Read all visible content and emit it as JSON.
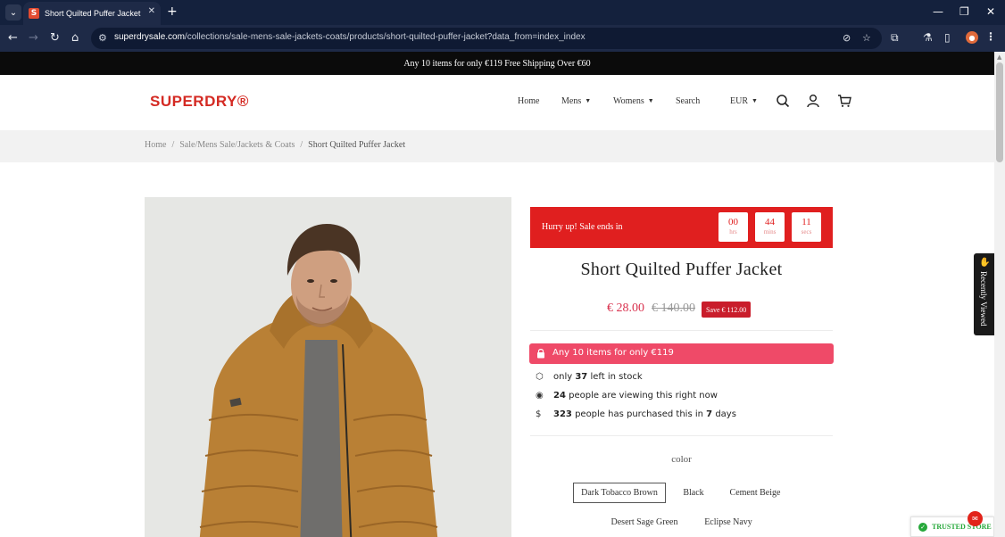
{
  "browser": {
    "tab_title": "Short Quilted Puffer Jacket - Su",
    "favicon_letter": "S",
    "url_host": "superdrysale.com",
    "url_path": "/collections/sale-mens-sale-jackets-coats/products/short-quilted-puffer-jacket?data_from=index_index"
  },
  "promo_bar": {
    "text": "Any 10 items for only €119 Free Shipping Over €60"
  },
  "header": {
    "logo": "SUPERDRY®",
    "nav": {
      "home": "Home",
      "mens": "Mens",
      "womens": "Womens",
      "search": "Search",
      "currency": "EUR"
    }
  },
  "breadcrumb": {
    "home": "Home",
    "category": "Sale/Mens Sale/Jackets & Coats",
    "current": "Short Quilted Puffer Jacket"
  },
  "sale_timer": {
    "label": "Hurry up!  Sale ends in",
    "hours": "00",
    "hours_unit": "hrs",
    "mins": "44",
    "mins_unit": "mins",
    "secs": "11",
    "secs_unit": "secs"
  },
  "product": {
    "title": "Short Quilted Puffer Jacket",
    "price_now": "€ 28.00",
    "price_was": "€ 140.00",
    "save_label": "Save € 112.00",
    "offer_text": "Any 10 items for only €119",
    "stock": {
      "prefix": "only",
      "count": "37",
      "suffix": "left in stock"
    },
    "viewing": {
      "count": "24",
      "suffix": "people are viewing this right now"
    },
    "purchased": {
      "count": "323",
      "mid": "people has purchased this in",
      "days": "7",
      "suffix": "days"
    },
    "color_label": "color",
    "colors": [
      "Dark Tobacco Brown",
      "Black",
      "Cement Beige",
      "Desert Sage Green",
      "Eclipse Navy"
    ],
    "selected_color": "Dark Tobacco Brown"
  },
  "recently_viewed": {
    "label": "Recently Viewed"
  },
  "trusted_badge": {
    "text": "TRUSTED STORE"
  },
  "colors": {
    "brand_red": "#d42a23",
    "sale_red": "#e01f1f",
    "price_pink": "#d9324e",
    "offer_pink": "#ef4a68",
    "trusted_green": "#26a83a"
  }
}
